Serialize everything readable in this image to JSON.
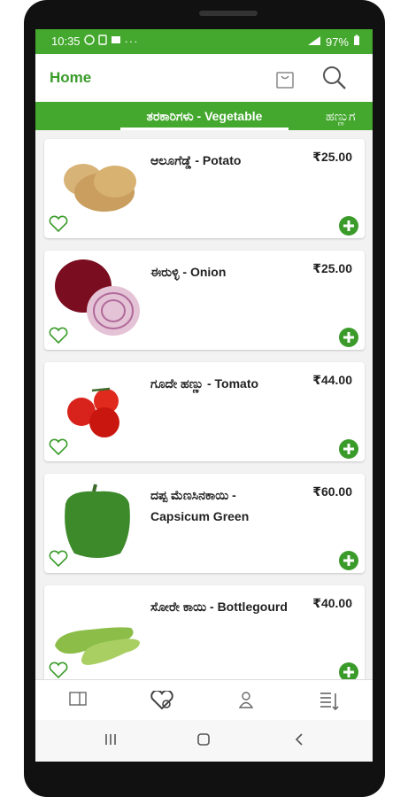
{
  "statusbar": {
    "time": "10:35",
    "left_icons": [
      "whatsapp-icon",
      "sim-icon",
      "media-icon",
      "more-icon"
    ],
    "battery_percent": "97%"
  },
  "appbar": {
    "title": "Home"
  },
  "tabs": {
    "active": "ತರಕಾರಿಗಳು - Vegetable",
    "next": "ಹಣ್ಣುಗ"
  },
  "products": [
    {
      "name": "ಆಲೂಗೆಡ್ಡೆ - Potato",
      "price": "₹25.00",
      "image": "potato"
    },
    {
      "name": "ಈರುಳ್ಳಿ - Onion",
      "price": "₹25.00",
      "image": "onion"
    },
    {
      "name": "ಗೂದೇ ಹಣ್ಣು - Tomato",
      "price": "₹44.00",
      "image": "tomato"
    },
    {
      "name": "ದಪ್ಪ ಮೆಣಸಿನಕಾಯಿ - Capsicum Green",
      "price": "₹60.00",
      "image": "capsicum"
    },
    {
      "name": "ಸೋರೇ ಕಾಯಿ - Bottlegourd",
      "price": "₹40.00",
      "image": "bottlegourd"
    }
  ],
  "bottom_nav": [
    "catalog-icon",
    "wishlist-icon",
    "profile-icon",
    "orders-icon"
  ],
  "colors": {
    "primary": "#43a82d",
    "title": "#3a9b2a",
    "add_button": "#3a9b2a"
  }
}
